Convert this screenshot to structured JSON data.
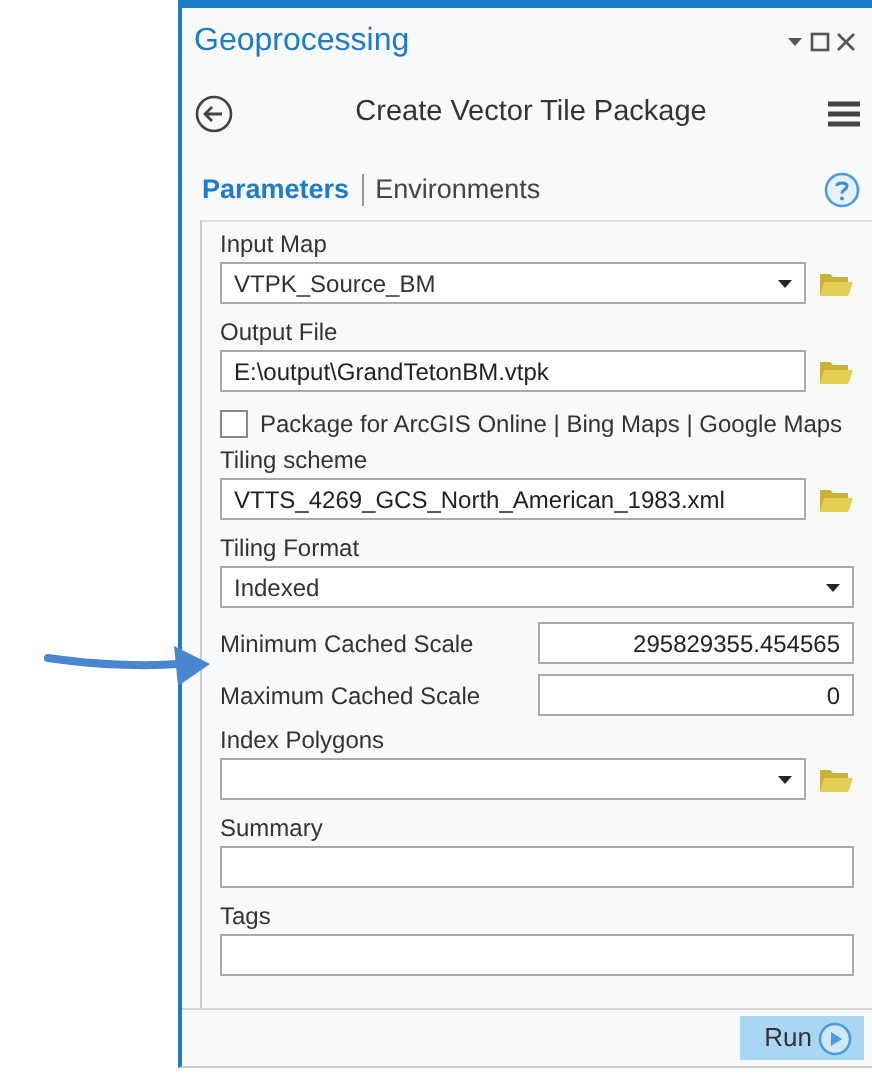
{
  "pane": {
    "title": "Geoprocessing"
  },
  "tool": {
    "title": "Create Vector Tile Package"
  },
  "tabs": [
    {
      "label": "Parameters",
      "selected": true
    },
    {
      "label": "Environments",
      "selected": false
    }
  ],
  "parameters": [
    {
      "kind": "dropdown",
      "label": "Input Map",
      "value": "VTPK_Source_BM",
      "browse": true
    },
    {
      "kind": "text",
      "label": "Output File",
      "value": "E:\\output\\GrandTetonBM.vtpk",
      "browse": true
    },
    {
      "kind": "checkbox",
      "label": "Package for ArcGIS Online | Bing Maps | Google Maps",
      "checked": false
    },
    {
      "kind": "text",
      "label": "Tiling scheme",
      "value": "VTTS_4269_GCS_North_American_1983.xml",
      "browse": true
    },
    {
      "kind": "dropdown",
      "label": "Tiling Format",
      "value": "Indexed",
      "browse": false
    },
    {
      "kind": "inline",
      "label": "Minimum Cached Scale",
      "value": "295829355.454565"
    },
    {
      "kind": "inline",
      "label": "Maximum Cached Scale",
      "value": "0"
    },
    {
      "kind": "dropdown",
      "label": "Index Polygons",
      "browse": true
    },
    {
      "kind": "text",
      "label": "Summary",
      "browse": false
    },
    {
      "kind": "text",
      "label": "Tags",
      "browse": false
    }
  ],
  "run_button": {
    "label": "Run"
  }
}
